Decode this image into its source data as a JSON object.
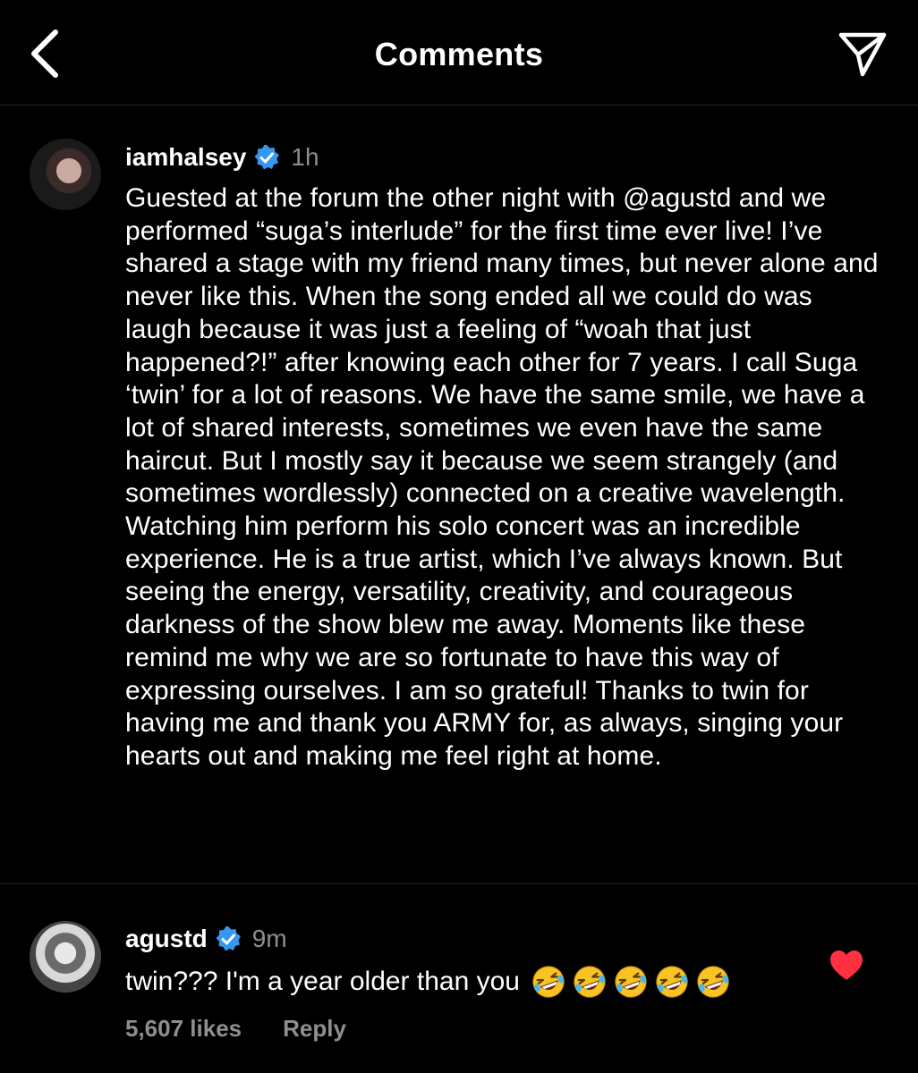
{
  "header": {
    "title": "Comments"
  },
  "post": {
    "username": "iamhalsey",
    "time": "1h",
    "caption": "Guested at the forum the other night with @agustd and we performed “suga’s interlude” for the first time ever live! I’ve shared a stage with my friend many times, but never alone and never like this. When the song ended all we could do was laugh because it was just a feeling of “woah that just happened?!” after knowing each other for 7 years. I call Suga ‘twin’ for a lot of reasons. We have the same smile, we have a lot of shared interests, sometimes we even have the same haircut. But I mostly say it because we seem strangely (and sometimes wordlessly) connected on a creative wavelength. Watching him perform his solo concert was an incredible experience. He is a true artist, which I’ve always known. But seeing the energy, versatility, creativity, and courageous darkness of the show blew me away. Moments like these remind me why we are so fortunate to have this way of expressing ourselves. I am so grateful! Thanks to twin for having me and thank you ARMY for, as always, singing your hearts out and making me feel right at home."
  },
  "comment": {
    "username": "agustd",
    "time": "9m",
    "text": "twin??? I'm a year older than you",
    "emoji_count": 5,
    "likes": "5,607 likes",
    "reply_label": "Reply",
    "liked": true
  },
  "colors": {
    "background": "#000000",
    "text": "#ffffff",
    "secondary_text": "#8e8e8e",
    "verified_badge": "#3797f0",
    "heart": "#ff3040",
    "divider": "#262626"
  },
  "icons": {
    "back": "chevron-left-icon",
    "share": "paper-plane-icon",
    "verified": "verified-badge-icon",
    "like": "heart-icon",
    "emoji": "rolling-on-floor-laughing-emoji"
  }
}
